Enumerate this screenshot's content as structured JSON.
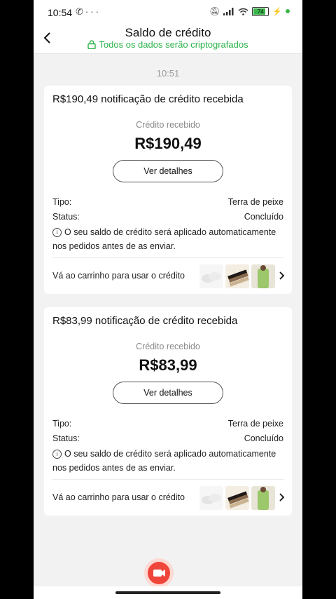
{
  "status_bar": {
    "time": "10:54",
    "battery": "74"
  },
  "header": {
    "title": "Saldo de crédito",
    "subtitle": "Todos os dados serão criptografados"
  },
  "timestamp": "10:51",
  "cards": [
    {
      "title": "R$190,49 notificação de crédito recebida",
      "received_label": "Crédito recebido",
      "amount": "R$190,49",
      "details_button": "Ver detalhes",
      "type_label": "Tipo:",
      "type_value": "Terra de peixe",
      "status_label": "Status:",
      "status_value": "Concluído",
      "note": "O seu saldo de crédito será aplicado automaticamente nos pedidos antes de as enviar.",
      "cart_link": "Vá ao carrinho para usar o crédito"
    },
    {
      "title": "R$83,99 notificação de crédito recebida",
      "received_label": "Crédito recebido",
      "amount": "R$83,99",
      "details_button": "Ver detalhes",
      "type_label": "Tipo:",
      "type_value": "Terra de peixe",
      "status_label": "Status:",
      "status_value": "Concluído",
      "note": "O seu saldo de crédito será aplicado automaticamente nos pedidos antes de as enviar.",
      "cart_link": "Vá ao carrinho para usar o crédito"
    }
  ],
  "colors": {
    "accent_green": "#2bb34b",
    "fab_red": "#f0453a"
  },
  "icons": [
    "whatsapp-icon",
    "more-icon",
    "mute-icon",
    "signal-icon",
    "wifi-icon",
    "battery-icon",
    "back-icon",
    "lock-icon",
    "info-icon",
    "chevron-right-icon",
    "video-icon"
  ]
}
